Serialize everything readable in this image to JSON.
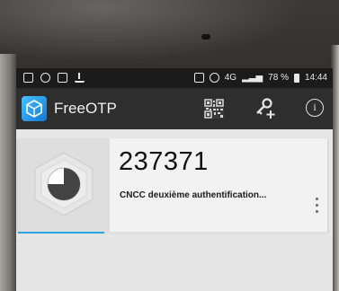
{
  "status_bar": {
    "battery": "78 %",
    "time": "14:44",
    "network": "4G",
    "icons": [
      "image-icon",
      "chat-icon",
      "mail-icon",
      "download-icon",
      "vibrate-icon",
      "alarm-icon",
      "signal-icon",
      "battery-icon"
    ]
  },
  "app_bar": {
    "title": "FreeOTP",
    "actions": [
      "qr-code-icon",
      "add-key-icon",
      "info-icon"
    ],
    "info_glyph": "i"
  },
  "token": {
    "code": "237371",
    "label": "CNCC deuxième authentification...",
    "progress_fraction": 0.28
  },
  "colors": {
    "app_bar": "#2e2e2e",
    "status_bar": "#1b1b1b",
    "accent": "#2aa5e0",
    "card": "#f2f2f2"
  }
}
